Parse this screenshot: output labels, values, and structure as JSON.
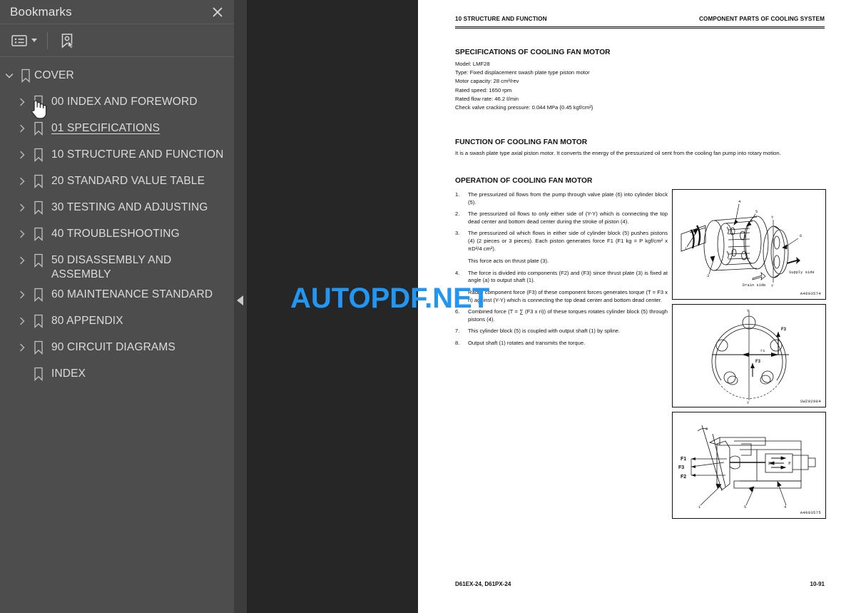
{
  "sidebar": {
    "title": "Bookmarks",
    "close_icon": "close-icon",
    "toolbar": {
      "options_label": "list-options-icon",
      "caret_label": "chevron-down-icon",
      "select_bookmark_label": "select-bookmark-icon"
    },
    "tree": [
      {
        "label": "COVER",
        "level": 0,
        "expanded": true,
        "has_children": true,
        "hovered": false
      },
      {
        "label": "00 INDEX AND FOREWORD",
        "level": 1,
        "expanded": false,
        "has_children": true,
        "hovered": false
      },
      {
        "label": "01 SPECIFICATIONS",
        "level": 1,
        "expanded": false,
        "has_children": true,
        "hovered": true
      },
      {
        "label": "10 STRUCTURE AND FUNCTION",
        "level": 1,
        "expanded": false,
        "has_children": true,
        "hovered": false
      },
      {
        "label": "20 STANDARD VALUE TABLE",
        "level": 1,
        "expanded": false,
        "has_children": true,
        "hovered": false
      },
      {
        "label": "30 TESTING AND ADJUSTING",
        "level": 1,
        "expanded": false,
        "has_children": true,
        "hovered": false
      },
      {
        "label": "40 TROUBLESHOOTING",
        "level": 1,
        "expanded": false,
        "has_children": true,
        "hovered": false
      },
      {
        "label": "50 DISASSEMBLY AND ASSEMBLY",
        "level": 1,
        "expanded": false,
        "has_children": true,
        "hovered": false
      },
      {
        "label": "60 MAINTENANCE STANDARD",
        "level": 1,
        "expanded": false,
        "has_children": true,
        "hovered": false
      },
      {
        "label": "80 APPENDIX",
        "level": 1,
        "expanded": false,
        "has_children": true,
        "hovered": false
      },
      {
        "label": "90 CIRCUIT DIAGRAMS",
        "level": 1,
        "expanded": false,
        "has_children": true,
        "hovered": false
      },
      {
        "label": "INDEX",
        "level": 1,
        "expanded": false,
        "has_children": false,
        "hovered": false
      }
    ]
  },
  "watermark": {
    "text": "AUTOPDF.NET",
    "color": "#2196f3"
  },
  "document": {
    "running_head_left": "10 STRUCTURE AND FUNCTION",
    "running_head_right": "COMPONENT PARTS OF COOLING SYSTEM",
    "footer_left": "D61EX-24, D61PX-24",
    "footer_right": "10-91",
    "spec_heading": "SPECIFICATIONS OF COOLING FAN MOTOR",
    "spec_lines": [
      "Model: LMF28",
      "Type: Fixed displacement swash plate type piston motor",
      "Motor capacity: 28 cm³/rev",
      "Rated speed: 1650 rpm",
      "Rated flow rate: 46.2 ℓ/min",
      "Check valve cracking pressure: 0.044 MPa {0.45 kgf/cm²}"
    ],
    "function_heading": "FUNCTION OF COOLING FAN MOTOR",
    "function_text": "It is a swash plate type axial piston motor. It converts the energy of the pressurized oil sent from the cooling fan pump into rotary motion.",
    "operation_heading": "OPERATION OF COOLING FAN MOTOR",
    "operation_items": [
      {
        "n": "1.",
        "text": "The pressurized oil flows from the pump through valve plate (6) into cylinder block (5)."
      },
      {
        "n": "2.",
        "text": "The pressurized oil flows to only either side of (Y-Y) which is connecting the top dead center and bottom dead center during the stroke of piston (4)."
      },
      {
        "n": "3.",
        "text": "The pressurized oil which flows in either side of cylinder block (5) pushes pistons (4) (2 pieces or 3 pieces). Each piston generates force F1 (F1 kg = P kgf/cm² x πD²/4 cm²).",
        "sub": "This force acts on thrust plate (3)."
      },
      {
        "n": "4.",
        "text": "The force is divided into components (F2) and (F3) since thrust plate (3) is fixed at angle (a) to output shaft (1)."
      },
      {
        "n": "5.",
        "text": "Radial component force (F3) of these component forces generates torque (T = F3 x ri) against (Y-Y) which is connecting the top dead center and bottom dead center."
      },
      {
        "n": "6.",
        "text": "Combined force (T = ∑ (F3 x ri)) of these torques rotates cylinder block (5) through pistons (4)."
      },
      {
        "n": "7.",
        "text": "This cylinder block (5) is coupled with output shaft (1) by spline."
      },
      {
        "n": "8.",
        "text": "Output shaft (1) rotates and transmits the torque."
      }
    ],
    "figures": [
      {
        "name": "cooling-fan-motor-cutaway",
        "code": "A4003574",
        "callouts": [
          "1",
          "3",
          "4",
          "5",
          "6"
        ],
        "annotations": [
          "Supply side",
          "Drain side",
          "Y",
          "Y"
        ]
      },
      {
        "name": "piston-force-diagram",
        "code": "SWZ02984",
        "callouts": [],
        "annotations": [
          "Y",
          "Y",
          "F3",
          "F3",
          "ri"
        ]
      },
      {
        "name": "motor-cross-section",
        "code": "A4003575",
        "callouts": [
          "1",
          "4",
          "5"
        ],
        "annotations": [
          "F1",
          "F2",
          "F3",
          "a",
          "D",
          "P"
        ]
      }
    ]
  }
}
